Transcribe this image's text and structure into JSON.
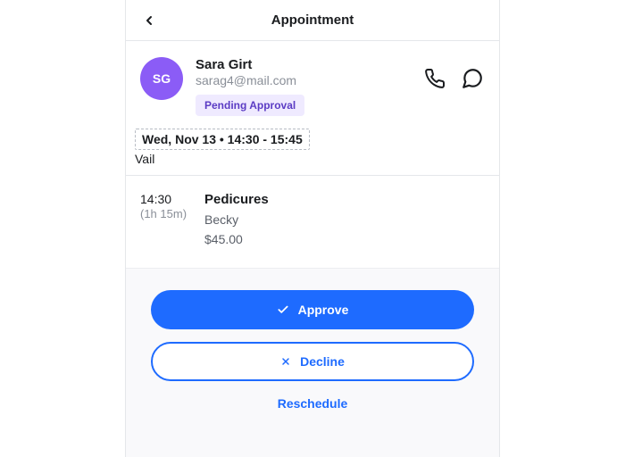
{
  "header": {
    "title": "Appointment"
  },
  "client": {
    "initials": "SG",
    "name": "Sara Girt",
    "email": "sarag4@mail.com",
    "status_badge": "Pending Approval"
  },
  "schedule": {
    "datetime": "Wed, Nov 13 • 14:30 - 15:45",
    "location": "Vail"
  },
  "service": {
    "start_time": "14:30",
    "duration": "(1h 15m)",
    "name": "Pedicures",
    "staff": "Becky",
    "price": "$45.00"
  },
  "actions": {
    "approve": "Approve",
    "decline": "Decline",
    "reschedule": "Reschedule"
  }
}
